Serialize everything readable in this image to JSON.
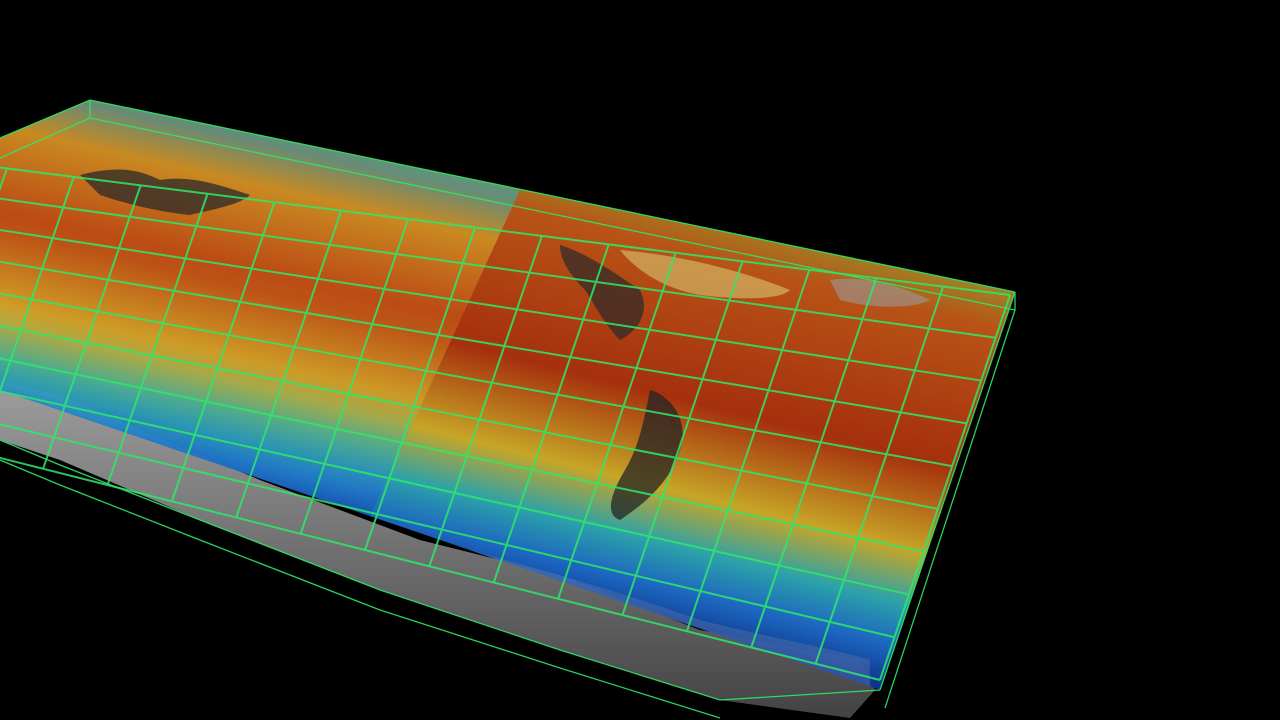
{
  "scene": {
    "background_color": "#000000",
    "colormap": [
      "#0a2a8a",
      "#1f6fd0",
      "#2fb0b8",
      "#8ec83a",
      "#d8b42a",
      "#c85a18",
      "#b4340e"
    ],
    "grid_color": "#2ee86a",
    "terrain_color": "#8a8a8a",
    "grid_columns": 16,
    "grid_rows": 9
  }
}
